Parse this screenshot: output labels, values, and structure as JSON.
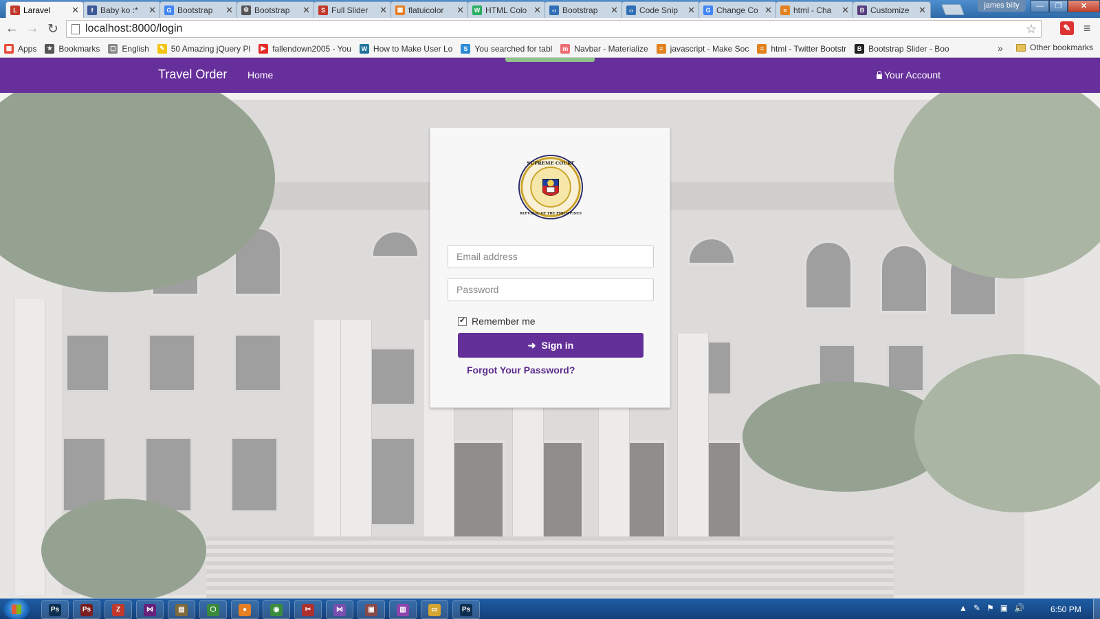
{
  "browser": {
    "tabs": [
      {
        "title": "Laravel",
        "active": true,
        "fav_color": "#c0392b",
        "fav_glyph": "L"
      },
      {
        "title": "Baby ko :*",
        "active": false,
        "fav_color": "#3b5998",
        "fav_glyph": "f"
      },
      {
        "title": "Bootstrap",
        "active": false,
        "fav_color": "#4285f4",
        "fav_glyph": "G"
      },
      {
        "title": "Bootstrap",
        "active": false,
        "fav_color": "#555555",
        "fav_glyph": "⚙"
      },
      {
        "title": "Full Slider",
        "active": false,
        "fav_color": "#c0392b",
        "fav_glyph": "S"
      },
      {
        "title": "flatuicolor",
        "active": false,
        "fav_color": "#e67e22",
        "fav_glyph": "▦"
      },
      {
        "title": "HTML Colo",
        "active": false,
        "fav_color": "#27ae60",
        "fav_glyph": "W"
      },
      {
        "title": "Bootstrap",
        "active": false,
        "fav_color": "#2f6fb5",
        "fav_glyph": "‹›"
      },
      {
        "title": "Code Snip",
        "active": false,
        "fav_color": "#2f6fb5",
        "fav_glyph": "‹›"
      },
      {
        "title": "Change Co",
        "active": false,
        "fav_color": "#4285f4",
        "fav_glyph": "G"
      },
      {
        "title": "html - Cha",
        "active": false,
        "fav_color": "#e2821f",
        "fav_glyph": "≡"
      },
      {
        "title": "Customize",
        "active": false,
        "fav_color": "#563d7c",
        "fav_glyph": "B"
      }
    ],
    "tab_close": "✕",
    "user": "james billy",
    "window_buttons": {
      "minimize": "—",
      "maximize": "❐",
      "close": "✕"
    },
    "nav": {
      "back": "←",
      "forward": "→",
      "reload": "↻"
    },
    "url": "localhost:8000/login",
    "star": "☆",
    "ext_glyph": "✎",
    "menu_glyph": "≡",
    "bookmarks": [
      {
        "label": "Apps",
        "color": "#e74c3c",
        "glyph": "▦"
      },
      {
        "label": "Bookmarks",
        "color": "#555555",
        "glyph": "★"
      },
      {
        "label": "English",
        "color": "#888888",
        "glyph": "▢"
      },
      {
        "label": "50 Amazing jQuery Pl",
        "color": "#f1c40f",
        "glyph": "✎"
      },
      {
        "label": "fallendown2005 - You",
        "color": "#e52d27",
        "glyph": "▶"
      },
      {
        "label": "How to Make User Lo",
        "color": "#21759b",
        "glyph": "W"
      },
      {
        "label": "You searched for tabl",
        "color": "#2c8bd6",
        "glyph": "S"
      },
      {
        "label": "Navbar - Materialize",
        "color": "#ee6e73",
        "glyph": "m"
      },
      {
        "label": "javascript - Make Soc",
        "color": "#e2821f",
        "glyph": "≡"
      },
      {
        "label": "html - Twitter Bootstr",
        "color": "#e2821f",
        "glyph": "≡"
      },
      {
        "label": "Bootstrap Slider - Boo",
        "color": "#222222",
        "glyph": "B"
      }
    ],
    "bookmarks_more": "»",
    "other_bookmarks": "Other bookmarks"
  },
  "app": {
    "brand": "Travel Order",
    "nav_home": "Home",
    "nav_account": "Your Account",
    "brand_color": "#672f9b"
  },
  "login": {
    "seal_text_top": "SUPREME COURT",
    "seal_text_bottom": "REPUBLIC OF THE PHILIPPINES",
    "email_placeholder": "Email address",
    "password_placeholder": "Password",
    "remember_label": "Remember me",
    "remember_checked": true,
    "signin_icon": "➜",
    "signin_label": "Sign in",
    "forgot_label": "Forgot Your Password?"
  },
  "taskbar": {
    "apps": [
      {
        "name": "photoshop",
        "color": "#0d2f4f",
        "glyph": "Ps"
      },
      {
        "name": "photoshop-alt",
        "color": "#7a1f1f",
        "glyph": "Ps"
      },
      {
        "name": "sublime",
        "color": "#c0392b",
        "glyph": "Z"
      },
      {
        "name": "visual-studio",
        "color": "#68217a",
        "glyph": "⋈"
      },
      {
        "name": "media",
        "color": "#7f6a3a",
        "glyph": "▤"
      },
      {
        "name": "network",
        "color": "#3a8a3a",
        "glyph": "⬡"
      },
      {
        "name": "firefox",
        "color": "#e67e22",
        "glyph": "●"
      },
      {
        "name": "chrome",
        "color": "#3b8d3b",
        "glyph": "◉"
      },
      {
        "name": "snipping",
        "color": "#b03030",
        "glyph": "✂"
      },
      {
        "name": "visual-studio-2",
        "color": "#7a4fb0",
        "glyph": "⋈"
      },
      {
        "name": "app-10",
        "color": "#8a4a4a",
        "glyph": "▣"
      },
      {
        "name": "winrar",
        "color": "#8e44ad",
        "glyph": "▥"
      },
      {
        "name": "explorer",
        "color": "#d4a530",
        "glyph": "▭"
      },
      {
        "name": "photoshop-3",
        "color": "#0d2f4f",
        "glyph": "Ps"
      }
    ],
    "tray_icons": [
      "▲",
      "✎",
      "⚑",
      "▣",
      "🔊"
    ],
    "clock": "6:50 PM"
  }
}
